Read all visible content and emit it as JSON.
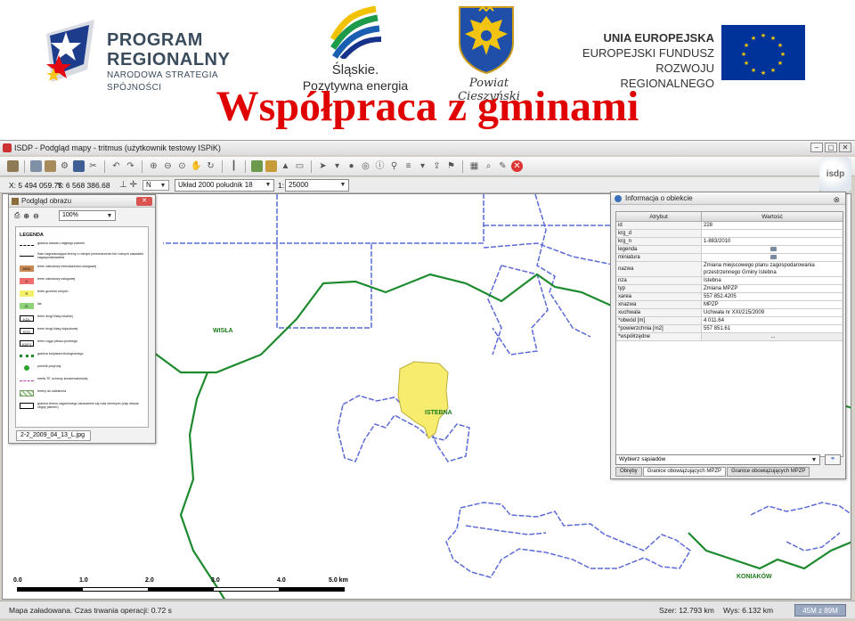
{
  "banner": {
    "program_line1": "PROGRAM",
    "program_line2": "REGIONALNY",
    "program_line3": "NARODOWA STRATEGIA SPÓJNOŚCI",
    "slaskie_name": "Śląskie.",
    "slaskie_tagline": "Pozytywna energia",
    "powiat_name": "Powiat Cieszyński",
    "ue_line1": "UNIA EUROPEJSKA",
    "ue_line2": "EUROPEJSKI FUNDUSZ",
    "ue_line3": "ROZWOJU REGIONALNEGO",
    "headline": "Współpraca z gminami"
  },
  "window": {
    "title": "ISDP - Podgląd mapy - tritmus (użytkownik testowy ISPiK)",
    "buttons": [
      "‒",
      "▢",
      "✕"
    ]
  },
  "toolbar": {
    "icons": [
      "print-icon",
      "copy-icon",
      "paste-icon",
      "settings-icon",
      "save-icon",
      "scissors-icon",
      "undo-icon",
      "redo-icon",
      "zoom-in-icon",
      "zoom-out-icon",
      "pan-icon",
      "layers-icon",
      "table-icon",
      "select-icon",
      "measure-icon",
      "info-icon",
      "filter-icon",
      "grid-icon",
      "close-icon"
    ],
    "logo": "isdp"
  },
  "coords": {
    "x": "X: 5 494 059.75",
    "y": "Y: 6 568 386.68",
    "direction": "N",
    "crs": "Układ 2000 południk 18",
    "scale_label": "1:",
    "scale_value": "25000"
  },
  "map": {
    "labels": {
      "wisla": "WISŁA",
      "istebna": "ISTEBNA",
      "koniakow": "KONIAKÓW"
    },
    "scalebar": [
      "0.0",
      "1.0",
      "2.0",
      "3.0",
      "4.0",
      "5.0 km"
    ],
    "colors": {
      "boundary": "#1e8a2e",
      "parcel": "#5c6bd6",
      "selection": "#f7ec6e"
    }
  },
  "status": {
    "message": "Mapa załadowana. Czas trwania operacji: 0.72 s",
    "width": "Szer: 12.793 km",
    "height": "Wys: 6.132 km",
    "memory": "45M z 89M"
  },
  "preview": {
    "title": "Podgląd obrazu",
    "zoom": "100%",
    "legend_title": "LEGENDA",
    "legend": [
      {
        "sym": "",
        "text": "granica obszaru objętego planem"
      },
      {
        "sym": "",
        "text": "linia rozgraniczająca tereny o różnym przeznaczeniu lub różnych zasadach zagospodarowania"
      },
      {
        "sym": "MNU",
        "text": "teren zabudowy mieszkaniowo-usługowej"
      },
      {
        "sym": "U",
        "text": "teren zabudowy usługowej"
      },
      {
        "sym": "R",
        "text": "teren gruntów rolnych"
      },
      {
        "sym": "ZL",
        "text": "las"
      },
      {
        "sym": "KDL",
        "text": "teren drogi klasy lokalnej"
      },
      {
        "sym": "KDD",
        "text": "teren drogi klasy dojazdowej"
      },
      {
        "sym": "KDPJ",
        "text": "teren ciągu pieszo-jezdnego"
      },
      {
        "sym": "",
        "text": "granica korytarza ekologicznego"
      },
      {
        "sym": "",
        "text": "pomnik przyrody"
      },
      {
        "sym": "",
        "text": "strefa \"B\" ochrony konserwatorskiej"
      },
      {
        "sym": "",
        "text": "tereny do zalesienia"
      },
      {
        "sym": "",
        "text": "granica terenu zagrożonego osuwaniem się mas ziemnych (cały obszar objęty planem)"
      }
    ],
    "tab": "2-2_2009_04_13_L.jpg"
  },
  "info": {
    "title": "Informacja o obiekcie",
    "col_attr": "Atrybut",
    "col_val": "Wartość",
    "rows": [
      {
        "attr": "id",
        "val": "228"
      },
      {
        "attr": "krg_d",
        "val": ""
      },
      {
        "attr": "krg_n",
        "val": "1-883/2010"
      },
      {
        "attr": "legenda",
        "val": "",
        "button": true
      },
      {
        "attr": "miniatura",
        "val": "",
        "button": true
      },
      {
        "attr": "nazwa",
        "val": "Zmiana miejscowego planu zagospodarowania przestrzennego Gminy Istebna"
      },
      {
        "attr": "nza",
        "val": "Istebna"
      },
      {
        "attr": "typ",
        "val": "Zmiana MPZP"
      },
      {
        "attr": "xarea",
        "val": "557 852.4205"
      },
      {
        "attr": "xnazwa",
        "val": "MPZP"
      },
      {
        "attr": "xuchwala",
        "val": "Uchwała nr XXI/215/2009"
      },
      {
        "attr": "*obwód [m]",
        "val": "4 011.64"
      },
      {
        "attr": "*powierzchnia [m2]",
        "val": "557 851.61"
      },
      {
        "attr": "*współrzędne",
        "val": "...",
        "center": true
      }
    ],
    "neighbors": "Wybierz sąsiadów",
    "tabs": [
      "Obręby",
      "Granice obowiązujących MPZP",
      "Granice obowiązujących MPZP"
    ]
  }
}
